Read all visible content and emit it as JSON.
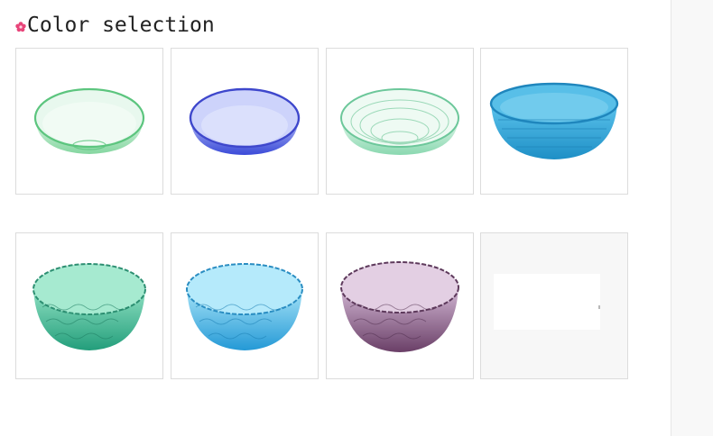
{
  "section": {
    "title": "Color selection",
    "bullet_icon": "flower-bullet-icon",
    "bullet_color": "#e8457a"
  },
  "swatches": [
    {
      "name": "bowl-green-clear",
      "color": "#5fcf8a"
    },
    {
      "name": "bowl-blue-violet",
      "color": "#4a5be0"
    },
    {
      "name": "bowl-mint-ribbed",
      "color": "#7fd8ae"
    },
    {
      "name": "bowl-sky-blue",
      "color": "#2fa3d6"
    },
    {
      "name": "bowl-teal-hammered",
      "color": "#36b58e"
    },
    {
      "name": "bowl-aqua-hammered",
      "color": "#3fb3e6"
    },
    {
      "name": "bowl-purple-hammered",
      "color": "#8a5d86"
    },
    {
      "name": "bowl-placeholder",
      "color": "#f7f7f7"
    }
  ]
}
